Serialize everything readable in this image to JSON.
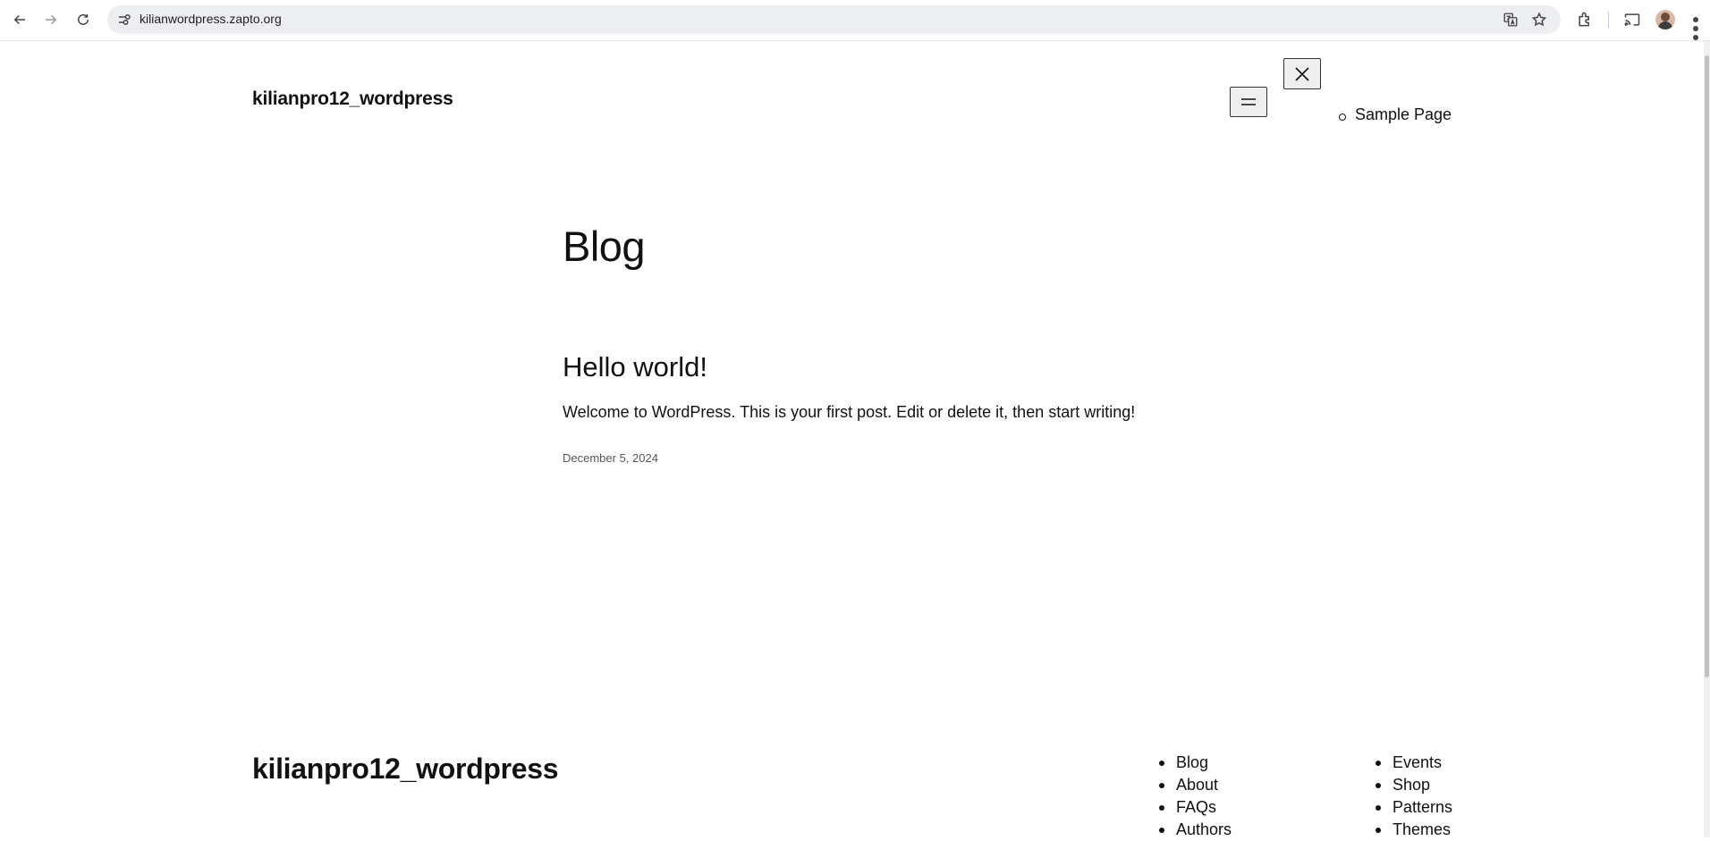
{
  "browser": {
    "url": "kilianwordpress.zapto.org",
    "icons": [
      "back-arrow-icon",
      "forward-arrow-icon",
      "reload-icon",
      "site-info-icon",
      "translate-icon",
      "bookmark-star-icon",
      "extensions-icon",
      "cast-icon",
      "profile-avatar",
      "more-menu-icon"
    ]
  },
  "header": {
    "site_title": "kilianpro12_wordpress",
    "overlay_menu": [
      "Sample Page"
    ]
  },
  "main": {
    "heading": "Blog",
    "posts": [
      {
        "title": "Hello world!",
        "excerpt": "Welcome to WordPress. This is your first post. Edit or delete it, then start writing!",
        "date": "December 5, 2024"
      }
    ]
  },
  "footer": {
    "site_title": "kilianpro12_wordpress",
    "column1": [
      "Blog",
      "About",
      "FAQs",
      "Authors"
    ],
    "column2": [
      "Events",
      "Shop",
      "Patterns",
      "Themes"
    ]
  }
}
